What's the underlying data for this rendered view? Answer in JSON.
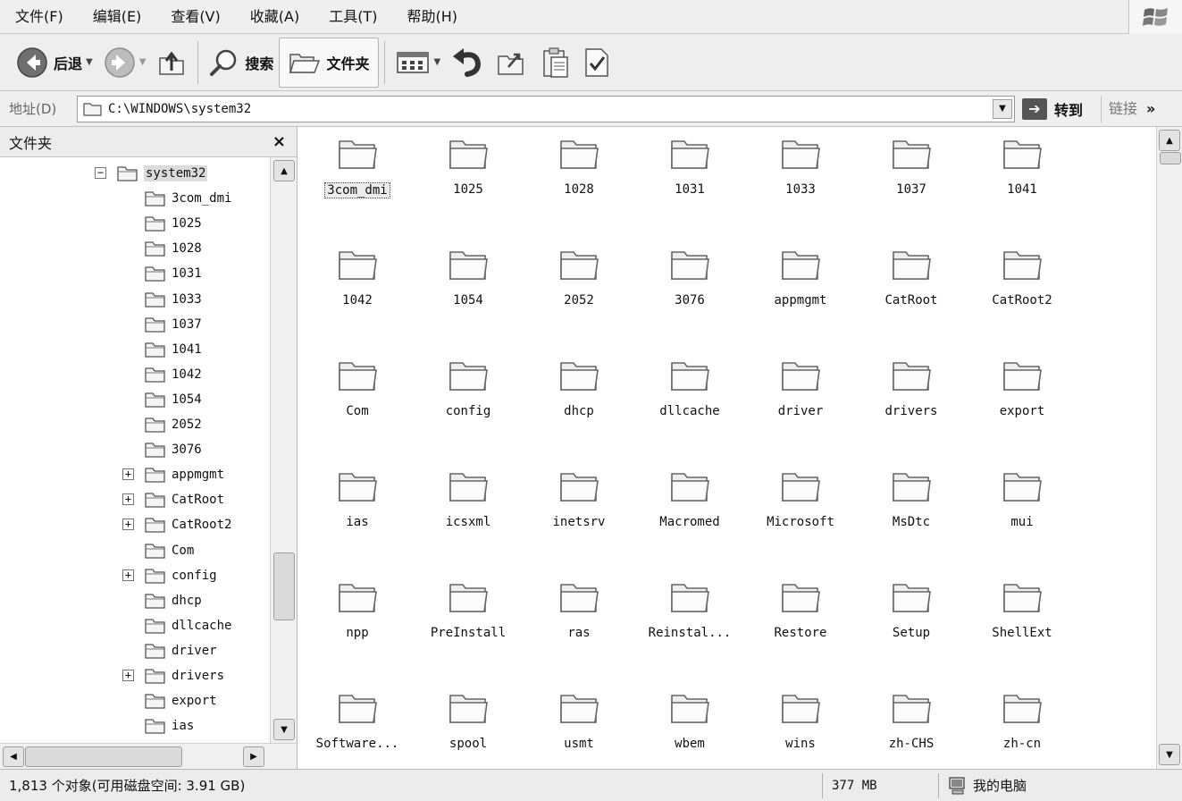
{
  "menu": [
    "文件(F)",
    "编辑(E)",
    "查看(V)",
    "收藏(A)",
    "工具(T)",
    "帮助(H)"
  ],
  "toolbar": {
    "back_label": "后退",
    "search_label": "搜索",
    "folders_label": "文件夹"
  },
  "address": {
    "label": "地址(D)",
    "value": "C:\\WINDOWS\\system32",
    "go_label": "转到",
    "links_label": "链接",
    "links_more": "»"
  },
  "folder_pane": {
    "title": "文件夹",
    "close": "×",
    "tree": [
      {
        "label": "system32",
        "expander": "−",
        "selected": true,
        "level": 0
      },
      {
        "label": "3com_dmi",
        "expander": "",
        "level": 1
      },
      {
        "label": "1025",
        "expander": "",
        "level": 1
      },
      {
        "label": "1028",
        "expander": "",
        "level": 1
      },
      {
        "label": "1031",
        "expander": "",
        "level": 1
      },
      {
        "label": "1033",
        "expander": "",
        "level": 1
      },
      {
        "label": "1037",
        "expander": "",
        "level": 1
      },
      {
        "label": "1041",
        "expander": "",
        "level": 1
      },
      {
        "label": "1042",
        "expander": "",
        "level": 1
      },
      {
        "label": "1054",
        "expander": "",
        "level": 1
      },
      {
        "label": "2052",
        "expander": "",
        "level": 1
      },
      {
        "label": "3076",
        "expander": "",
        "level": 1
      },
      {
        "label": "appmgmt",
        "expander": "+",
        "level": 1
      },
      {
        "label": "CatRoot",
        "expander": "+",
        "level": 1
      },
      {
        "label": "CatRoot2",
        "expander": "+",
        "level": 1
      },
      {
        "label": "Com",
        "expander": "",
        "level": 1
      },
      {
        "label": "config",
        "expander": "+",
        "level": 1
      },
      {
        "label": "dhcp",
        "expander": "",
        "level": 1
      },
      {
        "label": "dllcache",
        "expander": "",
        "level": 1
      },
      {
        "label": "driver",
        "expander": "",
        "level": 1
      },
      {
        "label": "drivers",
        "expander": "+",
        "level": 1
      },
      {
        "label": "export",
        "expander": "",
        "level": 1
      },
      {
        "label": "ias",
        "expander": "",
        "level": 1
      }
    ]
  },
  "content": {
    "folders": [
      "3com_dmi",
      "1025",
      "1028",
      "1031",
      "1033",
      "1037",
      "1041",
      "1042",
      "1054",
      "2052",
      "3076",
      "appmgmt",
      "CatRoot",
      "CatRoot2",
      "Com",
      "config",
      "dhcp",
      "dllcache",
      "driver",
      "drivers",
      "export",
      "ias",
      "icsxml",
      "inetsrv",
      "Macromed",
      "Microsoft",
      "MsDtc",
      "mui",
      "npp",
      "PreInstall",
      "ras",
      "Reinstal...",
      "Restore",
      "Setup",
      "ShellExt",
      "Software...",
      "spool",
      "usmt",
      "wbem",
      "wins",
      "zh-CHS",
      "zh-cn"
    ],
    "focused_index": 0
  },
  "status": {
    "objects": "1,813 个对象(可用磁盘空间: 3.91 GB)",
    "size": "377 MB",
    "location": "我的电脑"
  }
}
